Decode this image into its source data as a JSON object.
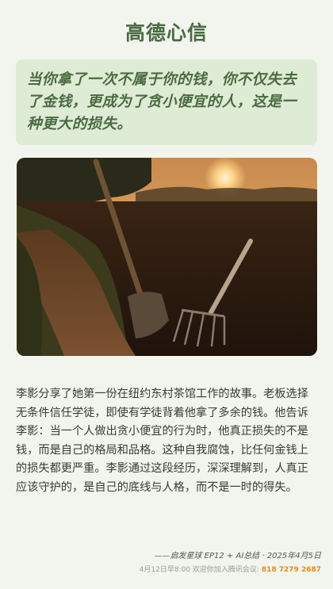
{
  "title": "高德心信",
  "quote": "当你拿了一次不属于你的钱，你不仅失去了金钱，更成为了贪小便宜的人，这是一种更大的损失。",
  "image": {
    "subject": "shovel-and-pitchfork-in-field-at-sunset"
  },
  "body": "李影分享了她第一份在纽约东村茶馆工作的故事。老板选择无条件信任学徒，即使有学徒背着他拿了多余的钱。他告诉李影：当一个人做出贪小便宜的行为时，他真正损失的不是钱，而是自己的格局和品格。这种自我腐蚀，比任何金钱上的损失都更严重。李影通过这段经历，深深理解到，人真正应该守护的，是自己的底线与人格，而不是一时的得失。",
  "footer": {
    "signature": "——启发星球 EP12 + AI总结 · 2025年4月5日",
    "note": "4月12日早8:00 欢迎你加入腾讯会议:",
    "meeting_id": "818 7279 2687"
  },
  "colors": {
    "background": "#f1f5ed",
    "accent": "#4a6a43",
    "quote_bg": "#deebd5",
    "highlight": "#e58a1f"
  }
}
